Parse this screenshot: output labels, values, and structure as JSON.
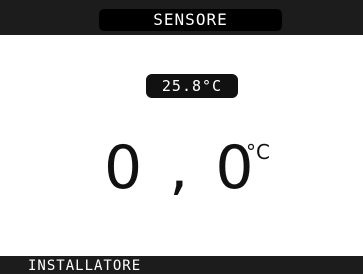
{
  "header": {
    "title": "SENSORE"
  },
  "sensor": {
    "reading_badge": "25.8°C",
    "value": "0,0",
    "unit": "°C"
  },
  "footer": {
    "label": "INSTALLATORE"
  },
  "colors": {
    "bar": "#1c1c1c",
    "pill": "#000000",
    "text_dark": "#111111",
    "text_light": "#ffffff",
    "background": "#ffffff"
  }
}
